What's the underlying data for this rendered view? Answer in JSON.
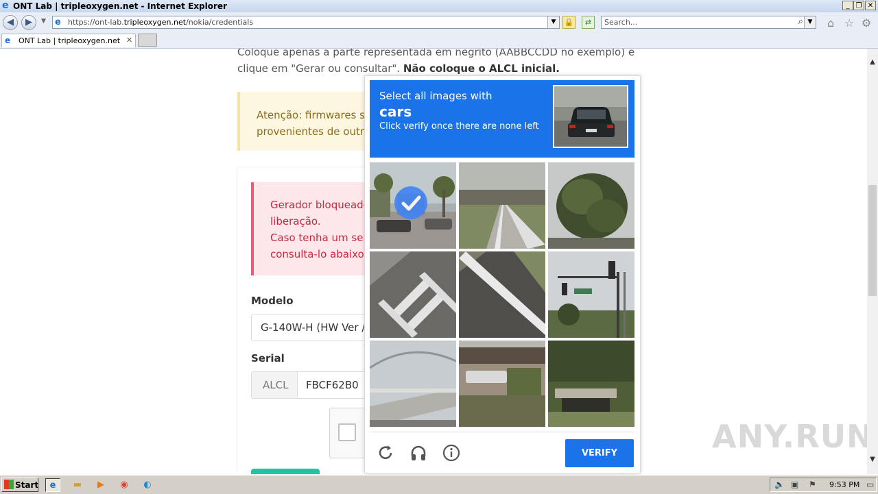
{
  "window": {
    "title": "ONT Lab | tripleoxygen.net - Internet Explorer",
    "minimize": "_",
    "restore": "❐",
    "close": "✕"
  },
  "nav": {
    "url_prefix": "https://ont-lab.",
    "url_domain": "tripleoxygen.net",
    "url_path": "/nokia/credentials",
    "search_placeholder": "Search..."
  },
  "tabs": [
    {
      "label": "ONT Lab | tripleoxygen.net"
    }
  ],
  "page": {
    "intro_line1": "Coloque apenas a parte representada em negrito (AABBCCDD no exemplo) e",
    "intro_line2": "clique em \"Gerar ou consultar\".",
    "intro_bold": "Não coloque o ALCL inicial.",
    "warning_line1": "Atenção: firmwares ser",
    "warning_line2": "provenientes de outro",
    "error_line1": "Gerador bloqueado",
    "error_line2": "liberação.",
    "error_line3": "Caso tenha um seria",
    "error_line4": "consulta-lo abaixo s",
    "model_label": "Modelo",
    "model_value": "G-140W-H (HW Ver /",
    "serial_label": "Serial",
    "serial_prefix": "ALCL",
    "serial_value": "FBCF62B0"
  },
  "captcha": {
    "instruction": "Select all images with",
    "target": "cars",
    "subtext": "Click verify once there are none left",
    "verify_label": "VERIFY",
    "tiles": [
      {
        "name": "tile-street-palms",
        "selected": true
      },
      {
        "name": "tile-road-overpass",
        "selected": false
      },
      {
        "name": "tile-palm-tree",
        "selected": false
      },
      {
        "name": "tile-crosswalk",
        "selected": false
      },
      {
        "name": "tile-road-line",
        "selected": false
      },
      {
        "name": "tile-traffic-light",
        "selected": false
      },
      {
        "name": "tile-bridge-railing",
        "selected": false
      },
      {
        "name": "tile-overpass-car",
        "selected": false
      },
      {
        "name": "tile-bridge-trees",
        "selected": false
      }
    ],
    "colors": {
      "primary": "#1a73e8",
      "check": "#4285f4"
    }
  },
  "taskbar": {
    "start_label": "Start",
    "clock": "9:53 PM"
  },
  "watermark": "ANY.RUN"
}
